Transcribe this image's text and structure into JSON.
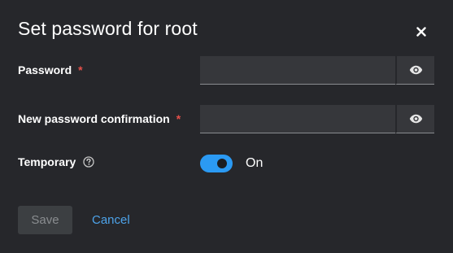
{
  "dialog": {
    "title": "Set password for root",
    "close_icon": "close-icon"
  },
  "fields": {
    "password": {
      "label": "Password",
      "required_mark": "*",
      "value": "",
      "placeholder": "",
      "toggle_icon": "eye-icon"
    },
    "confirmation": {
      "label": "New password confirmation",
      "required_mark": "*",
      "value": "",
      "placeholder": "",
      "toggle_icon": "eye-icon"
    },
    "temporary": {
      "label": "Temporary",
      "help_icon": "help-circle-icon",
      "state_label": "On",
      "checked": true
    }
  },
  "actions": {
    "save_label": "Save",
    "cancel_label": "Cancel"
  },
  "colors": {
    "background": "#26272b",
    "input_bg": "#36373b",
    "accent": "#2b9af3",
    "link": "#4da3ea",
    "required": "#e6504a",
    "disabled_button": "#3c3f42"
  }
}
